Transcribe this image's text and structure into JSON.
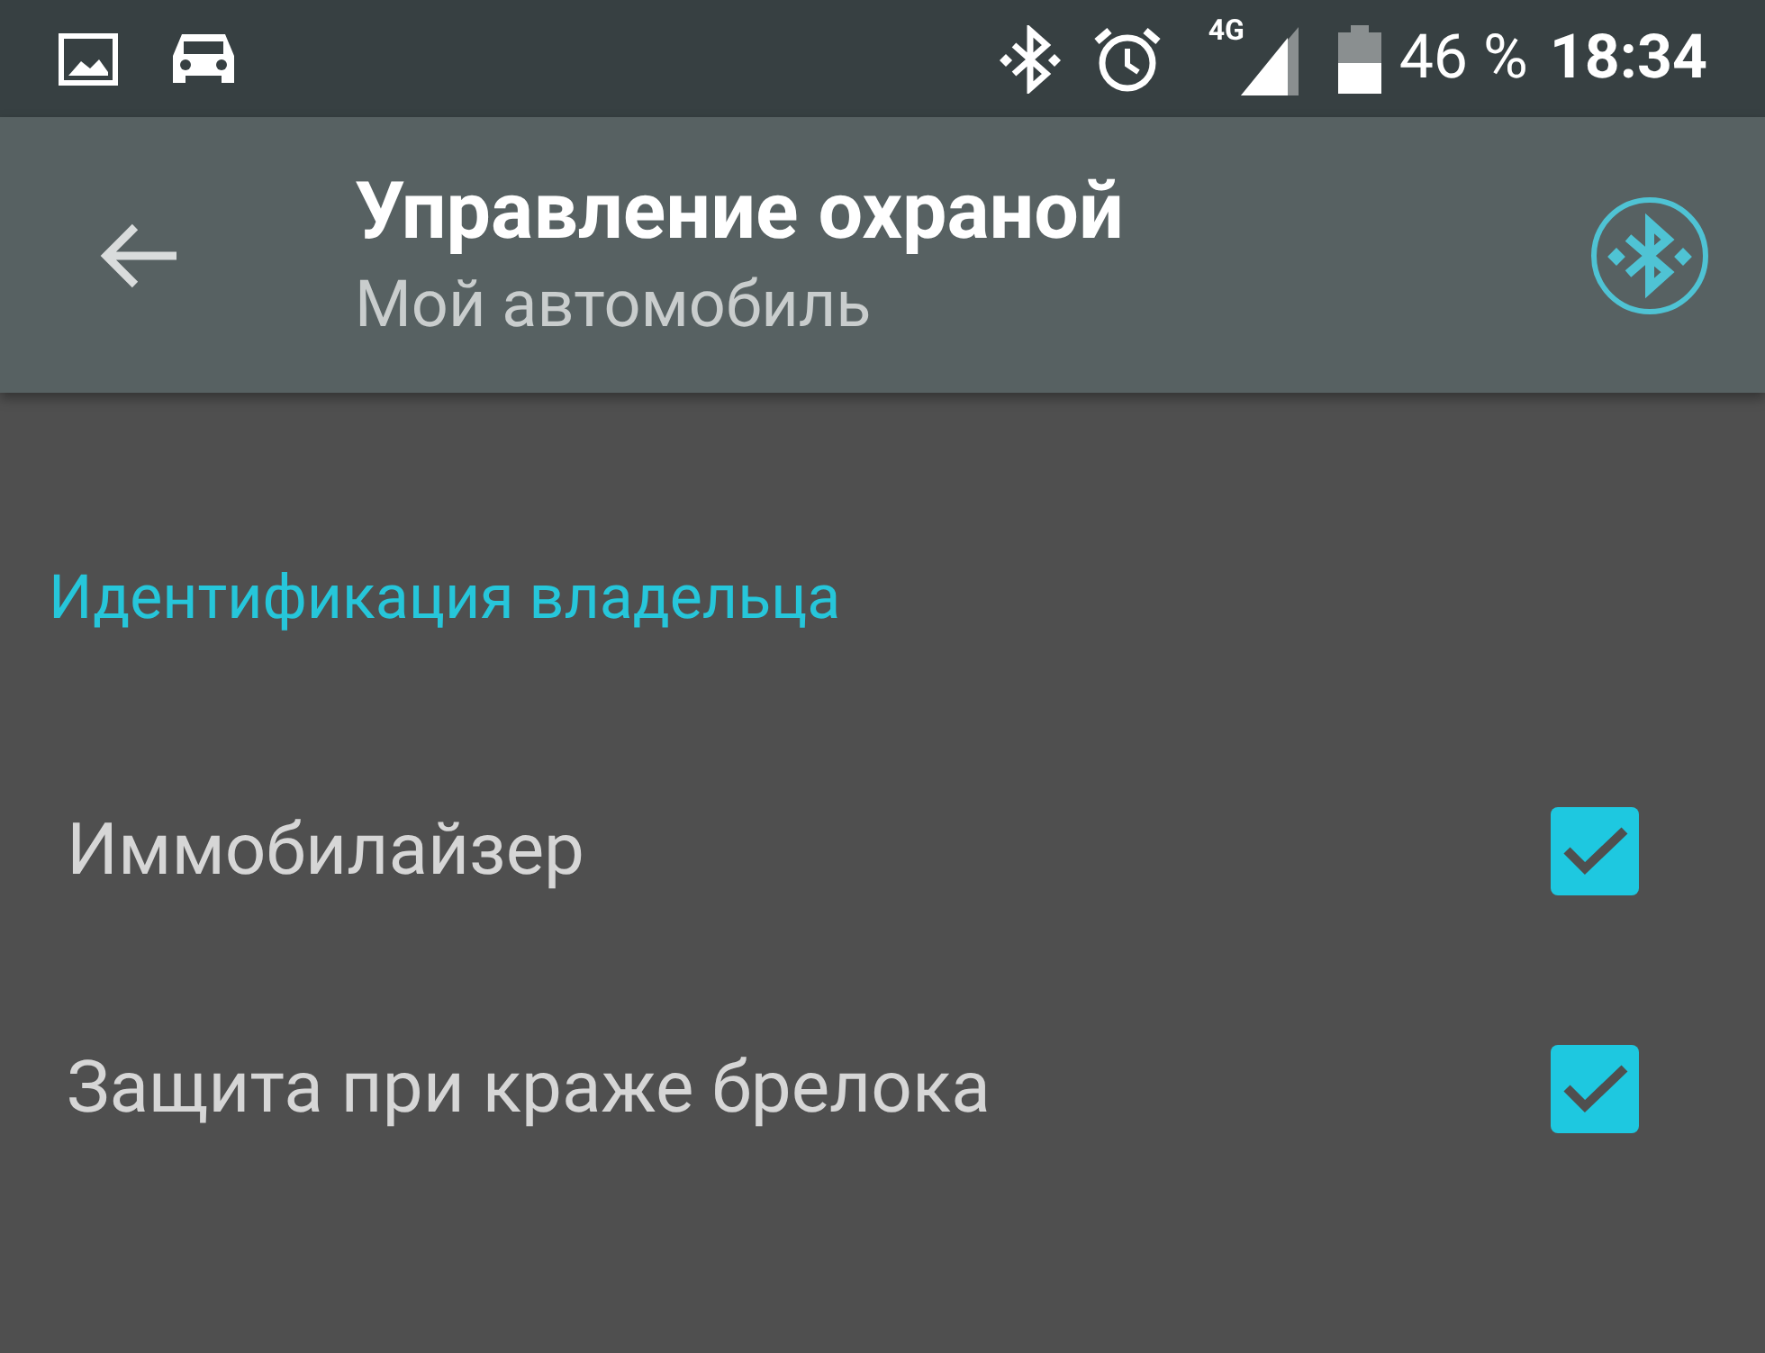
{
  "status_bar": {
    "battery": "46 %",
    "time": "18:34",
    "network": "4G"
  },
  "toolbar": {
    "title": "Управление охраной",
    "subtitle": "Мой автомобиль"
  },
  "section": {
    "title": "Идентификация владельца"
  },
  "settings": [
    {
      "label": "Иммобилайзер",
      "checked": true
    },
    {
      "label": "Защита при краже брелока",
      "checked": true
    }
  ]
}
